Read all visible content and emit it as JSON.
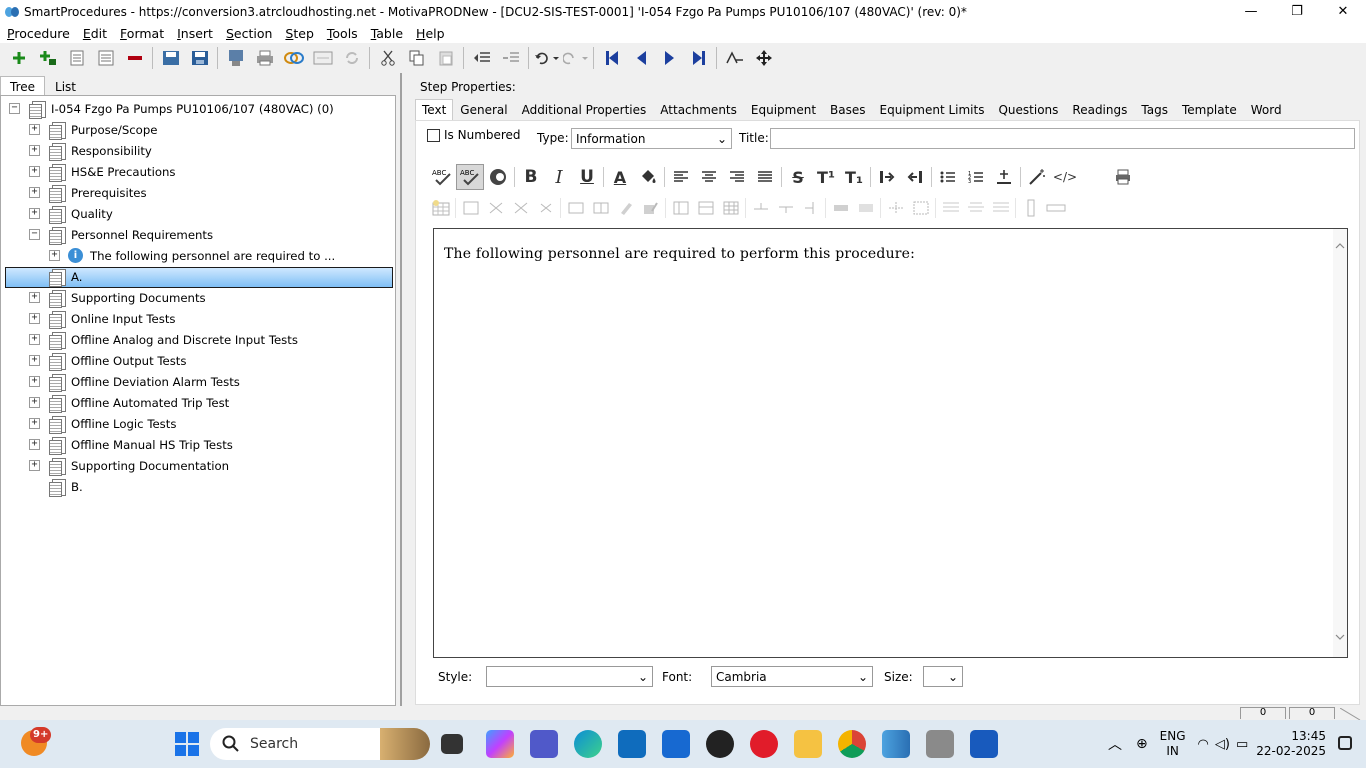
{
  "window": {
    "title": "SmartProcedures - https://conversion3.atrcloudhosting.net - MotivaPRODNew - [DCU2-SIS-TEST-0001] 'I-054 Fzgo Pa Pumps PU10106/107 (480VAC)' (rev: 0)*",
    "minimize": "—",
    "maximize": "❐",
    "close": "✕"
  },
  "menu": [
    {
      "first": "P",
      "rest": "rocedure"
    },
    {
      "first": "E",
      "rest": "dit"
    },
    {
      "first": "F",
      "rest": "ormat"
    },
    {
      "first": "I",
      "rest": "nsert"
    },
    {
      "first": "S",
      "rest": "ection"
    },
    {
      "first": "S",
      "rest": "tep"
    },
    {
      "first": "T",
      "rest": "ools"
    },
    {
      "first": "T",
      "rest": "able"
    },
    {
      "first": "H",
      "rest": "elp"
    }
  ],
  "left_tabs": {
    "tree": "Tree",
    "list": "List"
  },
  "tree": {
    "root": "I-054 Fzgo Pa Pumps PU10106/107 (480VAC) (0)",
    "items": [
      "Purpose/Scope",
      "Responsibility",
      "HS&E Precautions",
      "Prerequisites",
      "Quality",
      "Personnel Requirements",
      "The following personnel are required to ...",
      "A.",
      "Supporting Documents",
      "Online Input Tests",
      "Offline Analog and Discrete Input Tests",
      "Offline Output Tests",
      "Offline Deviation Alarm Tests",
      "Offline Automated Trip Test",
      "Offline Logic Tests",
      "Offline Manual HS Trip Tests",
      "Supporting Documentation",
      "B."
    ]
  },
  "step_properties": {
    "label": "Step Properties:",
    "tabs": [
      "Text",
      "General",
      "Additional Properties",
      "Attachments",
      "Equipment",
      "Bases",
      "Equipment Limits",
      "Questions",
      "Readings",
      "Tags",
      "Template",
      "Word"
    ],
    "is_numbered_label": "Is Numbered",
    "type_label": "Type:",
    "type_value": "Information",
    "title_label": "Title:",
    "title_value": "",
    "editor_text": "The following personnel are required to perform this procedure:",
    "style_label": "Style:",
    "style_value": "",
    "font_label": "Font:",
    "font_value": "Cambria",
    "size_label": "Size:",
    "size_value": ""
  },
  "format_buttons": {
    "bold": "B",
    "italic": "I",
    "underline": "U",
    "font_color": "A",
    "strike": "S",
    "superscript": "T¹",
    "subscript": "T₁",
    "html": "</>"
  },
  "status": {
    "field1": "0",
    "field2": "0"
  },
  "taskbar": {
    "search_placeholder": "Search",
    "notif_badge": "9+",
    "lang_line1": "ENG",
    "lang_line2": "IN",
    "time": "13:45",
    "date": "22-02-2025"
  }
}
